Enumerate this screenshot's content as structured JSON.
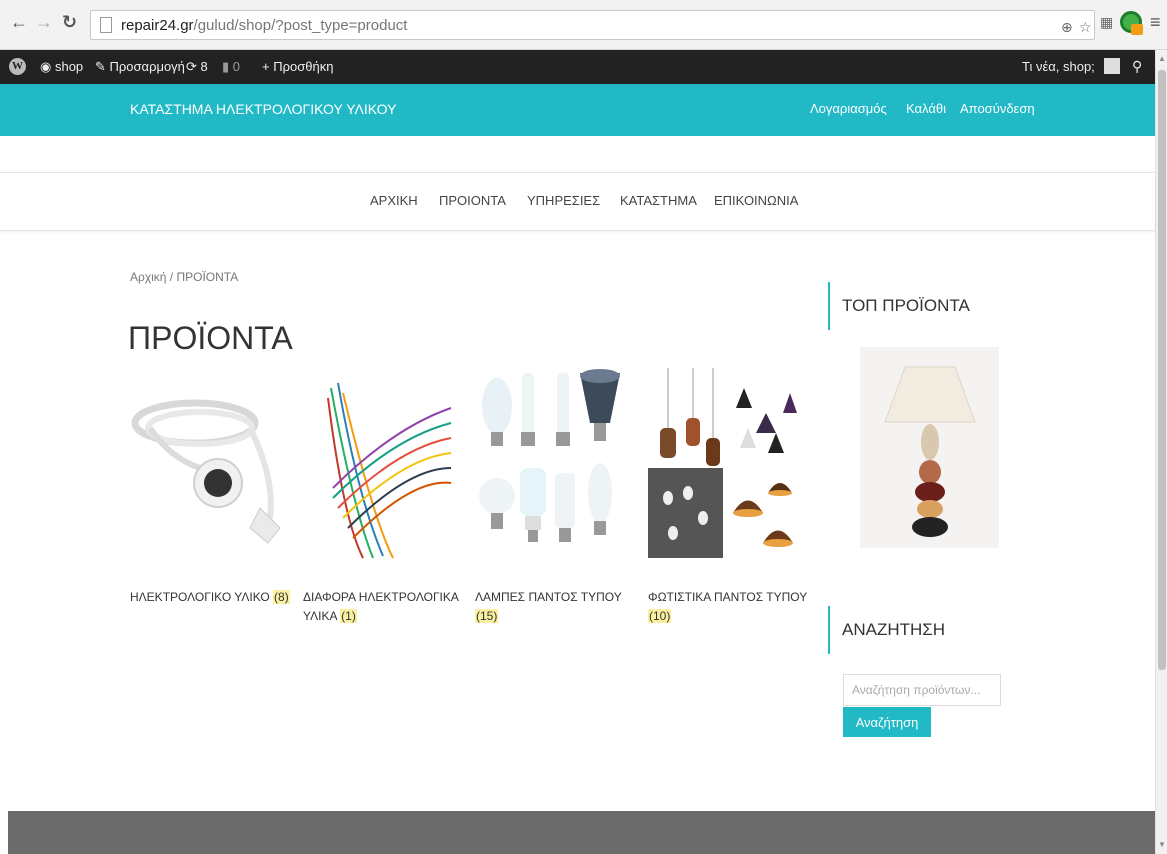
{
  "browser": {
    "url_host": "repair24.gr",
    "url_path": "/gulud/shop/?post_type=product"
  },
  "adminbar": {
    "site": "shop",
    "customize": "Προσαρμογή",
    "updates": "8",
    "comments": "0",
    "add_new": "Προσθήκη",
    "greeting": "Τι νέα, shop;"
  },
  "header": {
    "site_title": "ΚΑΤΑΣΤΗΜΑ ΗΛΕΚΤΡΟΛΟΓΙΚΟΥ ΥΛΙΚΟΥ",
    "links": [
      "Λογαριασμός",
      "Καλάθι",
      "Αποσύνδεση"
    ]
  },
  "nav": [
    "ΑΡΧΙΚΗ",
    "ΠΡΟΙΟΝΤΑ",
    "ΥΠΗΡΕΣΙΕΣ",
    "ΚΑΤΑΣΤΗΜΑ",
    "ΕΠΙΚΟΙΝΩΝΙΑ"
  ],
  "breadcrumb": "Αρχική / ΠΡΟΪΟΝΤΑ",
  "page_title": "ΠΡΟΪΟΝΤΑ",
  "categories": [
    {
      "name": "ΗΛΕΚΤΡΟΛΟΓΙΚΟ ΥΛΙΚΟ",
      "count": "(8)"
    },
    {
      "name": "ΔΙΑΦΟΡΑ ΗΛΕΚΤΡΟΛΟΓΙΚΑ ΥΛΙΚΑ",
      "count": "(1)"
    },
    {
      "name": "ΛΑΜΠΕΣ ΠΑΝΤΟΣ ΤΥΠΟΥ",
      "count": "(15)"
    },
    {
      "name": "ΦΩΤΙΣΤΙΚΑ ΠΑΝΤΟΣ ΤΥΠΟΥ",
      "count": "(10)"
    }
  ],
  "sidebar": {
    "top_products_title": "ΤΟΠ ΠΡΟΪΟΝΤΑ",
    "search_title": "ΑΝΑΖΗΤΗΣΗ",
    "search_placeholder": "Αναζήτηση προϊόντων...",
    "search_button": "Αναζήτηση"
  },
  "colors": {
    "accent": "#20b9c5",
    "adminbar": "#222222",
    "footer": "#6b6b6b",
    "count_highlight": "#fbf0a0"
  }
}
